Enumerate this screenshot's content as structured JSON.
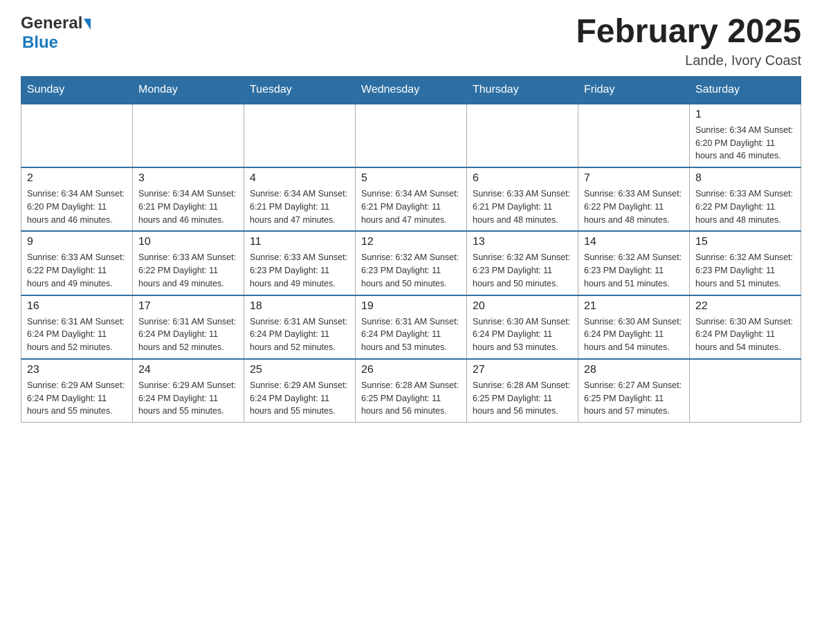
{
  "header": {
    "logo_general": "General",
    "logo_blue": "Blue",
    "month_title": "February 2025",
    "location": "Lande, Ivory Coast"
  },
  "weekdays": [
    "Sunday",
    "Monday",
    "Tuesday",
    "Wednesday",
    "Thursday",
    "Friday",
    "Saturday"
  ],
  "weeks": [
    [
      {
        "day": "",
        "info": ""
      },
      {
        "day": "",
        "info": ""
      },
      {
        "day": "",
        "info": ""
      },
      {
        "day": "",
        "info": ""
      },
      {
        "day": "",
        "info": ""
      },
      {
        "day": "",
        "info": ""
      },
      {
        "day": "1",
        "info": "Sunrise: 6:34 AM\nSunset: 6:20 PM\nDaylight: 11 hours and 46 minutes."
      }
    ],
    [
      {
        "day": "2",
        "info": "Sunrise: 6:34 AM\nSunset: 6:20 PM\nDaylight: 11 hours and 46 minutes."
      },
      {
        "day": "3",
        "info": "Sunrise: 6:34 AM\nSunset: 6:21 PM\nDaylight: 11 hours and 46 minutes."
      },
      {
        "day": "4",
        "info": "Sunrise: 6:34 AM\nSunset: 6:21 PM\nDaylight: 11 hours and 47 minutes."
      },
      {
        "day": "5",
        "info": "Sunrise: 6:34 AM\nSunset: 6:21 PM\nDaylight: 11 hours and 47 minutes."
      },
      {
        "day": "6",
        "info": "Sunrise: 6:33 AM\nSunset: 6:21 PM\nDaylight: 11 hours and 48 minutes."
      },
      {
        "day": "7",
        "info": "Sunrise: 6:33 AM\nSunset: 6:22 PM\nDaylight: 11 hours and 48 minutes."
      },
      {
        "day": "8",
        "info": "Sunrise: 6:33 AM\nSunset: 6:22 PM\nDaylight: 11 hours and 48 minutes."
      }
    ],
    [
      {
        "day": "9",
        "info": "Sunrise: 6:33 AM\nSunset: 6:22 PM\nDaylight: 11 hours and 49 minutes."
      },
      {
        "day": "10",
        "info": "Sunrise: 6:33 AM\nSunset: 6:22 PM\nDaylight: 11 hours and 49 minutes."
      },
      {
        "day": "11",
        "info": "Sunrise: 6:33 AM\nSunset: 6:23 PM\nDaylight: 11 hours and 49 minutes."
      },
      {
        "day": "12",
        "info": "Sunrise: 6:32 AM\nSunset: 6:23 PM\nDaylight: 11 hours and 50 minutes."
      },
      {
        "day": "13",
        "info": "Sunrise: 6:32 AM\nSunset: 6:23 PM\nDaylight: 11 hours and 50 minutes."
      },
      {
        "day": "14",
        "info": "Sunrise: 6:32 AM\nSunset: 6:23 PM\nDaylight: 11 hours and 51 minutes."
      },
      {
        "day": "15",
        "info": "Sunrise: 6:32 AM\nSunset: 6:23 PM\nDaylight: 11 hours and 51 minutes."
      }
    ],
    [
      {
        "day": "16",
        "info": "Sunrise: 6:31 AM\nSunset: 6:24 PM\nDaylight: 11 hours and 52 minutes."
      },
      {
        "day": "17",
        "info": "Sunrise: 6:31 AM\nSunset: 6:24 PM\nDaylight: 11 hours and 52 minutes."
      },
      {
        "day": "18",
        "info": "Sunrise: 6:31 AM\nSunset: 6:24 PM\nDaylight: 11 hours and 52 minutes."
      },
      {
        "day": "19",
        "info": "Sunrise: 6:31 AM\nSunset: 6:24 PM\nDaylight: 11 hours and 53 minutes."
      },
      {
        "day": "20",
        "info": "Sunrise: 6:30 AM\nSunset: 6:24 PM\nDaylight: 11 hours and 53 minutes."
      },
      {
        "day": "21",
        "info": "Sunrise: 6:30 AM\nSunset: 6:24 PM\nDaylight: 11 hours and 54 minutes."
      },
      {
        "day": "22",
        "info": "Sunrise: 6:30 AM\nSunset: 6:24 PM\nDaylight: 11 hours and 54 minutes."
      }
    ],
    [
      {
        "day": "23",
        "info": "Sunrise: 6:29 AM\nSunset: 6:24 PM\nDaylight: 11 hours and 55 minutes."
      },
      {
        "day": "24",
        "info": "Sunrise: 6:29 AM\nSunset: 6:24 PM\nDaylight: 11 hours and 55 minutes."
      },
      {
        "day": "25",
        "info": "Sunrise: 6:29 AM\nSunset: 6:24 PM\nDaylight: 11 hours and 55 minutes."
      },
      {
        "day": "26",
        "info": "Sunrise: 6:28 AM\nSunset: 6:25 PM\nDaylight: 11 hours and 56 minutes."
      },
      {
        "day": "27",
        "info": "Sunrise: 6:28 AM\nSunset: 6:25 PM\nDaylight: 11 hours and 56 minutes."
      },
      {
        "day": "28",
        "info": "Sunrise: 6:27 AM\nSunset: 6:25 PM\nDaylight: 11 hours and 57 minutes."
      },
      {
        "day": "",
        "info": ""
      }
    ]
  ]
}
